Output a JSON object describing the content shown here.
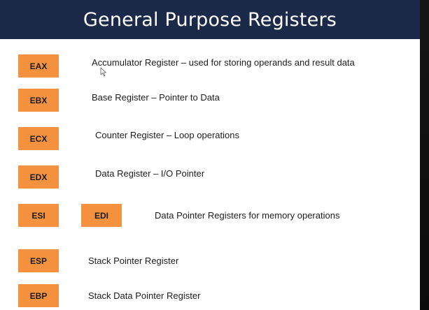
{
  "slide": {
    "title": "General Purpose Registers"
  },
  "registers": [
    {
      "name": "EAX",
      "description": "Accumulator Register – used for storing operands and result data"
    },
    {
      "name": "EBX",
      "description": "Base Register – Pointer to Data"
    },
    {
      "name": "ECX",
      "description": "Counter Register – Loop operations"
    },
    {
      "name": "EDX",
      "description": "Data Register – I/O Pointer"
    },
    {
      "name": "ESI",
      "second_name": "EDI",
      "description": "Data Pointer Registers for memory operations"
    },
    {
      "name": "ESP",
      "description": "Stack Pointer Register"
    },
    {
      "name": "EBP",
      "description": "Stack Data Pointer Register"
    }
  ],
  "colors": {
    "title_bar": "#1b2a48",
    "register_box": "#f59240",
    "background": "#ffffff"
  },
  "icons": {
    "cursor": "mouse-pointer-icon"
  }
}
